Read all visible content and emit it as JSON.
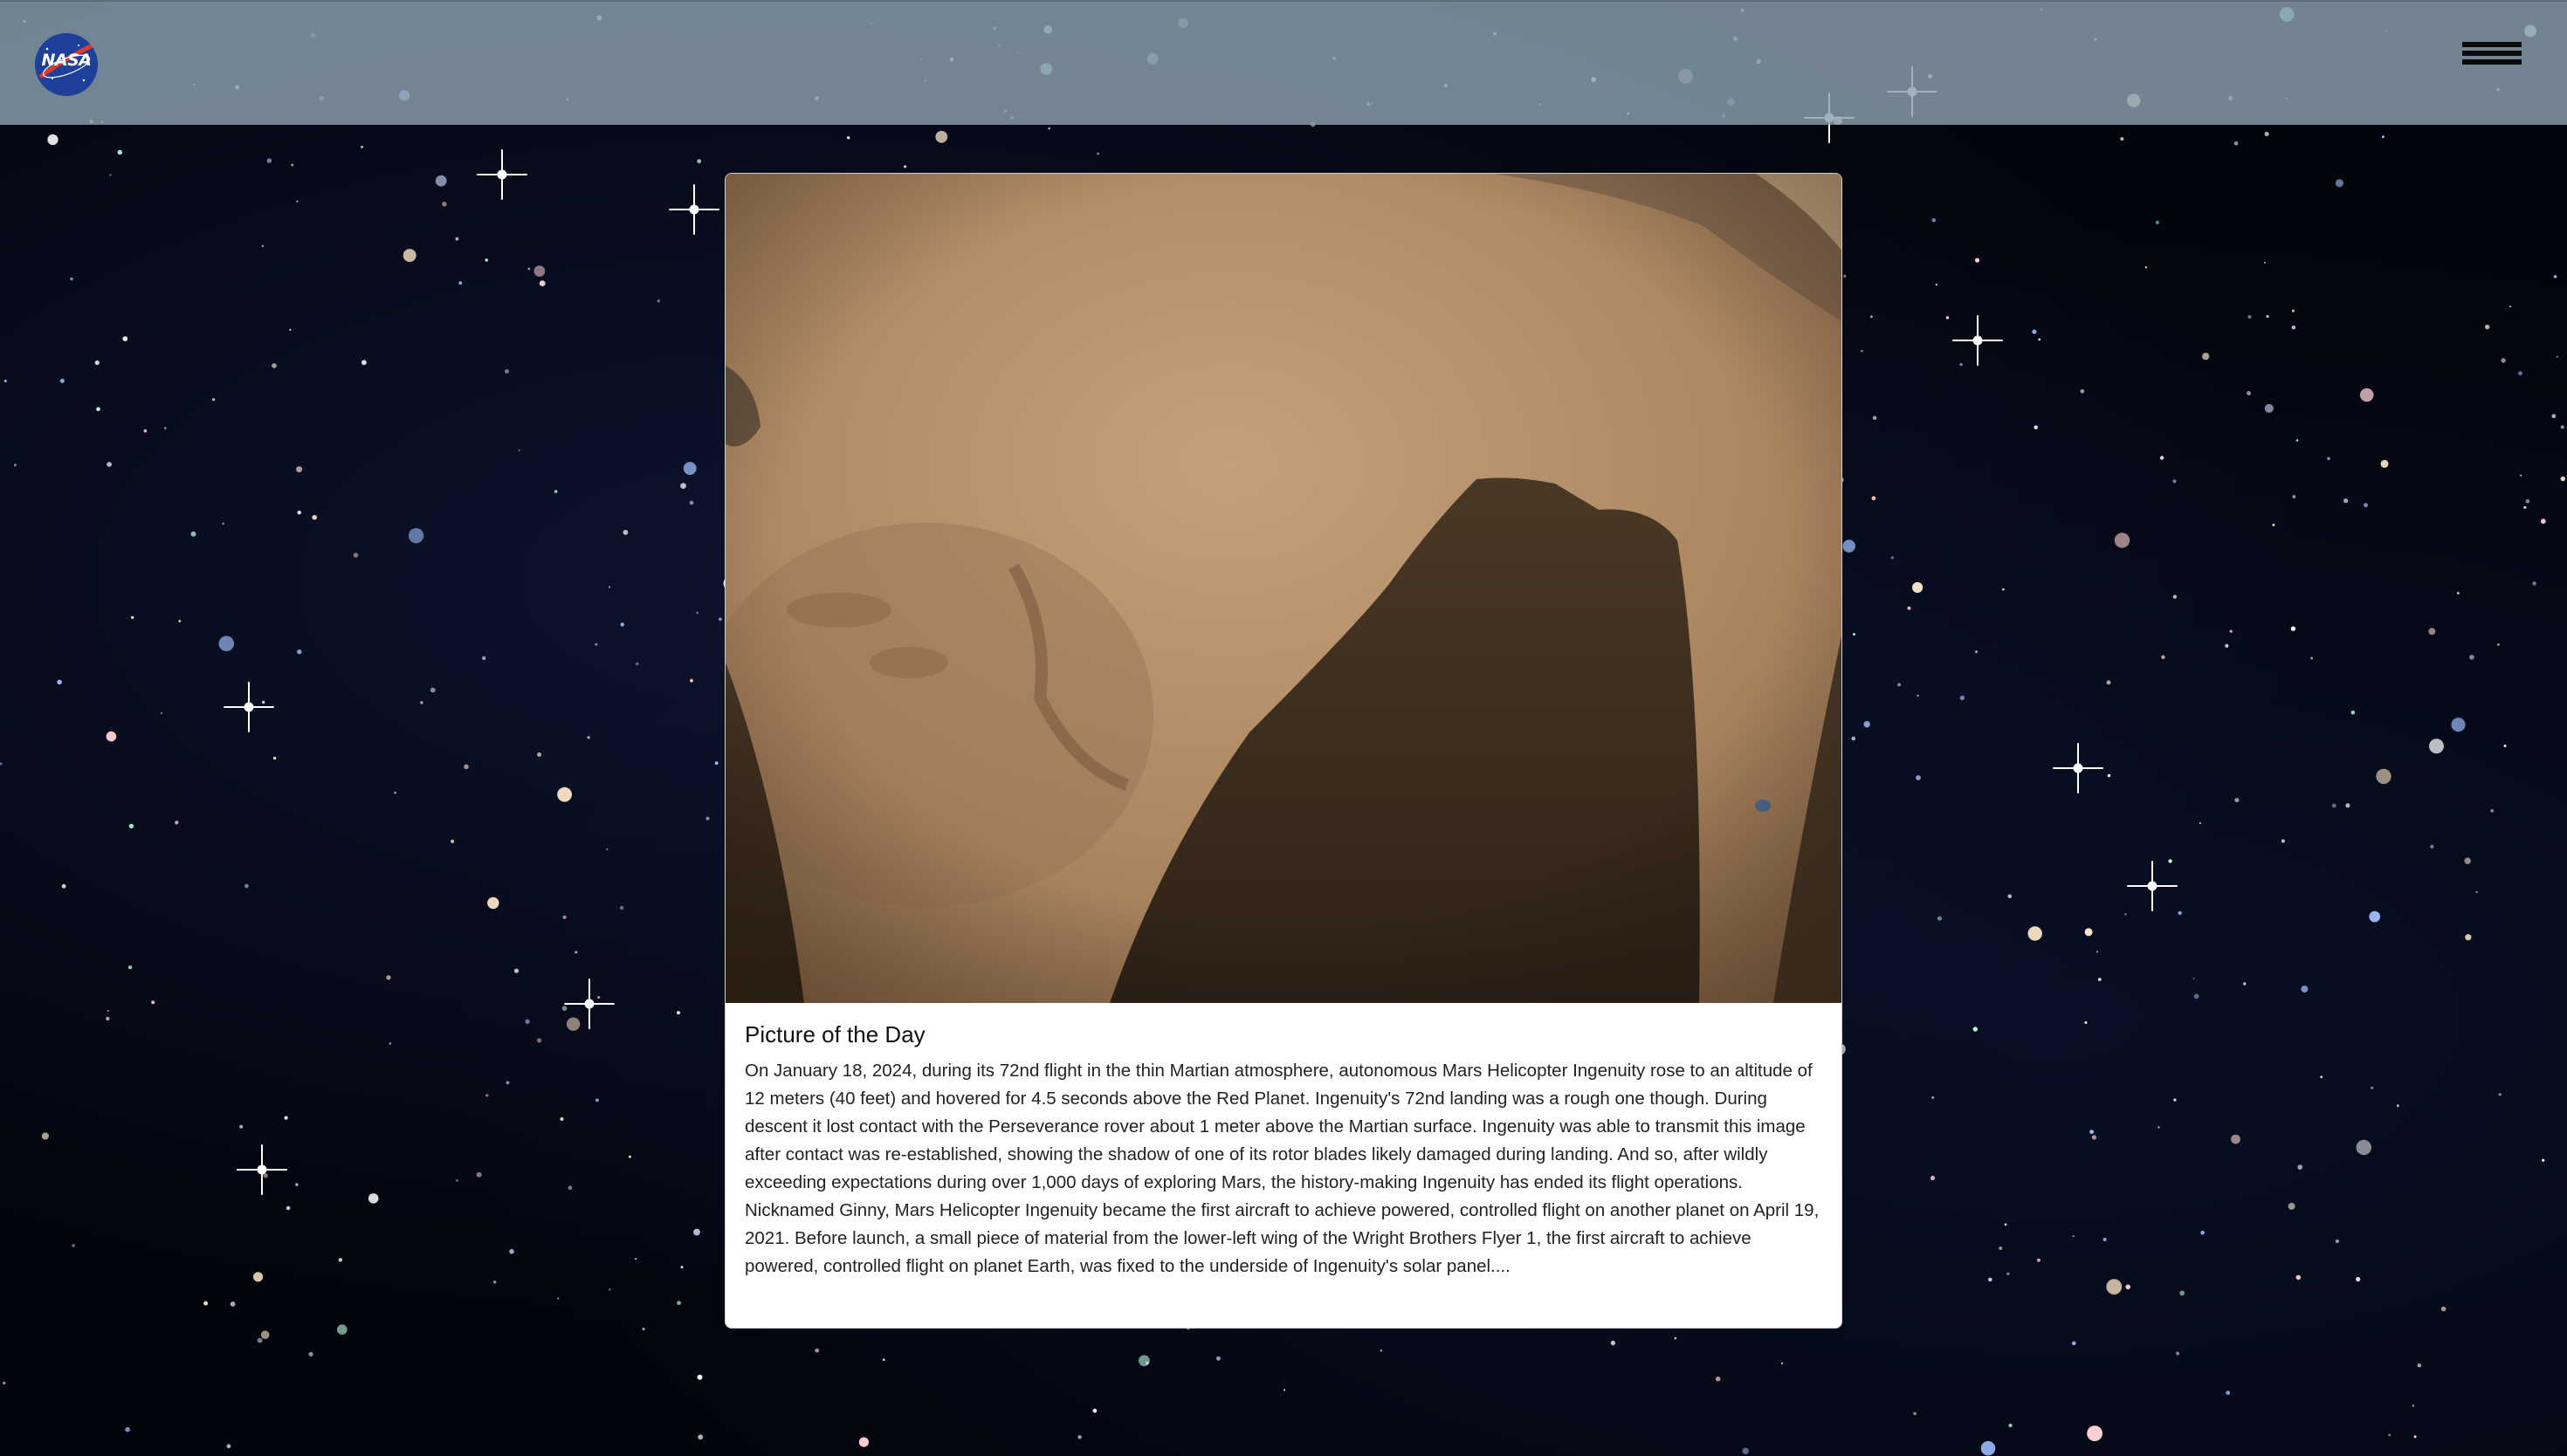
{
  "navbar": {
    "logo_text": "NASA",
    "menu_icon": "hamburger-menu-icon",
    "logo_icon": "nasa-logo-icon"
  },
  "card": {
    "image_description_icon": "mars-surface-photo",
    "title": "Picture of the Day",
    "text": "On January 18, 2024, during its 72nd flight in the thin Martian atmosphere, autonomous Mars Helicopter Ingenuity rose to an altitude of 12 meters (40 feet) and hovered for 4.5 seconds above the Red Planet. Ingenuity's 72nd landing was a rough one though. During descent it lost contact with the Perseverance rover about 1 meter above the Martian surface. Ingenuity was able to transmit this image after contact was re-established, showing the shadow of one of its rotor blades likely damaged during landing. And so, after wildly exceeding expectations during over 1,000 days of exploring Mars, the history-making Ingenuity has ended its flight operations. Nicknamed Ginny, Mars Helicopter Ingenuity became the first aircraft to achieve powered, controlled flight on another planet on April 19, 2021. Before launch, a small piece of material from the lower-left wing of the Wright Brothers Flyer 1, the first aircraft to achieve powered, controlled flight on planet Earth, was fixed to the underside of Ingenuity's solar panel...."
  },
  "colors": {
    "navbar": "#8ca0af",
    "nasa_blue": "#1e3f9a",
    "nasa_red": "#e03a2c",
    "mars_sand": "#b08a62",
    "shadow": "#3a2c1e"
  }
}
